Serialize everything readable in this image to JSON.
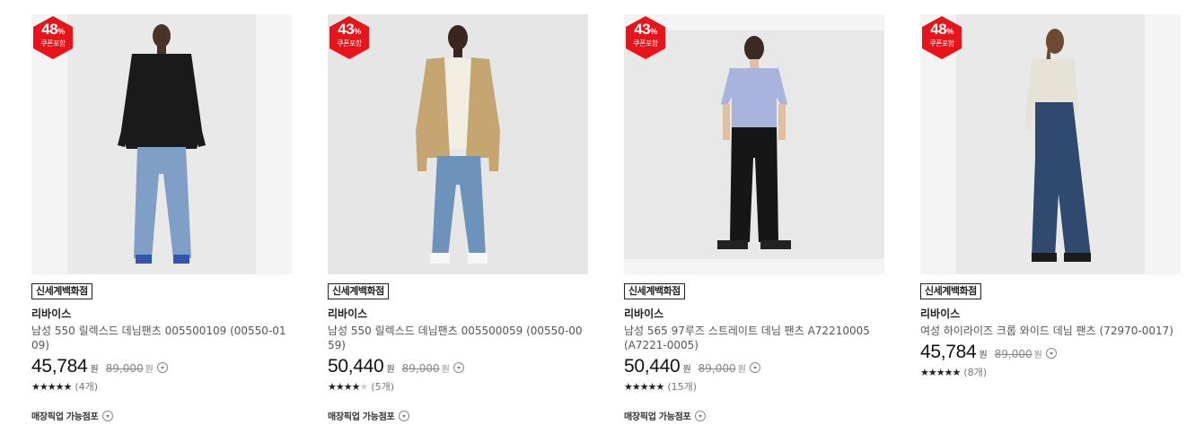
{
  "products": [
    {
      "discount": "48",
      "discount_unit": "%",
      "coupon_label": "쿠폰포함",
      "store": "신세계백화점",
      "brand": "리바이스",
      "name": "남성 550 릴렉스드 데님팬츠 005500109 (00550-0109)",
      "price": "45,784",
      "currency": "원",
      "original_price": "89,000",
      "rating_count": "(4개)",
      "stars": 5,
      "pickup_label": "매장픽업 가능점포",
      "top_color": "#1b1a1a",
      "pants_color": "#7f9fc6"
    },
    {
      "discount": "43",
      "discount_unit": "%",
      "coupon_label": "쿠폰포함",
      "store": "신세계백화점",
      "brand": "리바이스",
      "name": "남성 550 릴렉스드 데님팬츠 005500059 (00550-0059)",
      "price": "50,440",
      "currency": "원",
      "original_price": "89,000",
      "rating_count": "(5개)",
      "stars": 4,
      "pickup_label": "매장픽업 가능점포",
      "top_color": "#c6a670",
      "pants_color": "#6e93bb"
    },
    {
      "discount": "43",
      "discount_unit": "%",
      "coupon_label": "쿠폰포함",
      "store": "신세계백화점",
      "brand": "리바이스",
      "name": "남성 565 97루즈 스트레이트 데님 팬츠 A72210005 (A7221-0005)",
      "price": "50,440",
      "currency": "원",
      "original_price": "89,000",
      "rating_count": "(15개)",
      "stars": 5,
      "pickup_label": "매장픽업 가능점포",
      "top_color": "#a9b4dc",
      "pants_color": "#161616"
    },
    {
      "discount": "48",
      "discount_unit": "%",
      "coupon_label": "쿠폰포함",
      "store": "신세계백화점",
      "brand": "리바이스",
      "name": "여성 하이라이즈 크롭 와이드 데님 팬츠 (72970-0017)",
      "price": "45,784",
      "currency": "원",
      "original_price": "89,000",
      "rating_count": "(8개)",
      "stars": 5,
      "pickup_label": "",
      "top_color": "#e6e2d6",
      "pants_color": "#2f4a6e"
    }
  ],
  "colors": {
    "badge": "#e8141c",
    "image_bg": "#f4f4f4"
  }
}
